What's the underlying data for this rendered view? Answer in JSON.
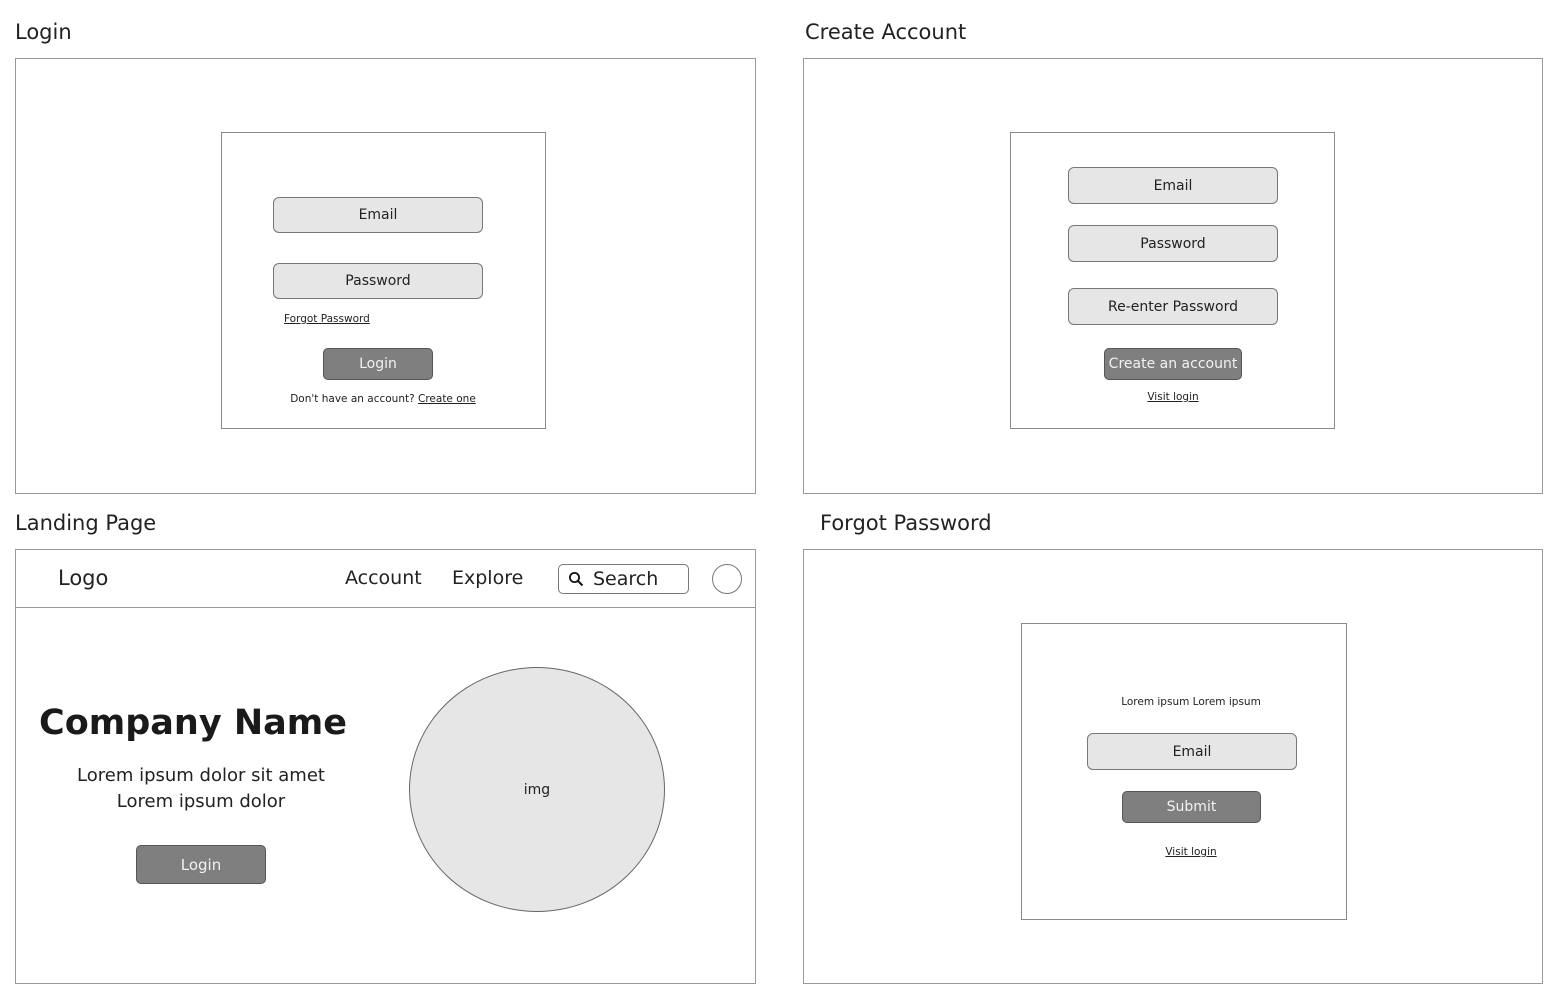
{
  "login": {
    "title": "Login",
    "email": "Email",
    "password": "Password",
    "forgot": "Forgot Password",
    "button": "Login",
    "no_account": "Don't have an account?",
    "create_link": "Create one"
  },
  "create_account": {
    "title": "Create Account",
    "email": "Email",
    "password": "Password",
    "reenter": "Re-enter Password",
    "button": "Create an account",
    "visit_login": "Visit login"
  },
  "landing": {
    "title": "Landing Page",
    "logo": "Logo",
    "nav": [
      "Account",
      "Explore"
    ],
    "search": "Search",
    "company": "Company Name",
    "tagline1": "Lorem ipsum dolor sit amet",
    "tagline2": "Lorem ipsum dolor",
    "button": "Login",
    "img": "img"
  },
  "forgot": {
    "title": "Forgot Password",
    "text": "Lorem ipsum Lorem ipsum",
    "email": "Email",
    "button": "Submit",
    "visit_login": "Visit login"
  }
}
